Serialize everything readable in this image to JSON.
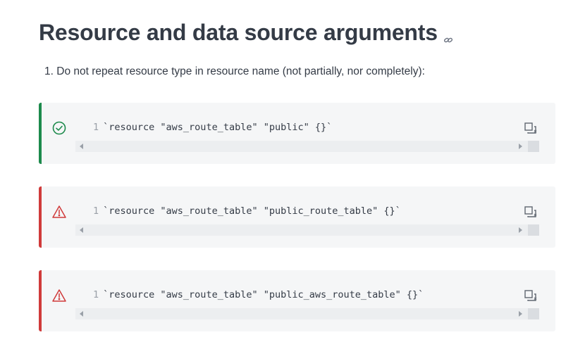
{
  "heading": {
    "title": "Resource and data source arguments"
  },
  "rules": [
    {
      "number": "1.",
      "text": "Do not repeat resource type in resource name (not partially, nor completely):"
    }
  ],
  "examples": [
    {
      "status": "good",
      "status_icon": "check-circle-icon",
      "color": "#1d8a4c",
      "line_number": "1",
      "code": "`resource \"aws_route_table\" \"public\" {}`"
    },
    {
      "status": "bad",
      "status_icon": "warning-triangle-icon",
      "color": "#d03a3a",
      "line_number": "1",
      "code": "`resource \"aws_route_table\" \"public_route_table\" {}`"
    },
    {
      "status": "bad",
      "status_icon": "warning-triangle-icon",
      "color": "#d03a3a",
      "line_number": "1",
      "code": "`resource \"aws_route_table\" \"public_aws_route_table\" {}`"
    }
  ]
}
